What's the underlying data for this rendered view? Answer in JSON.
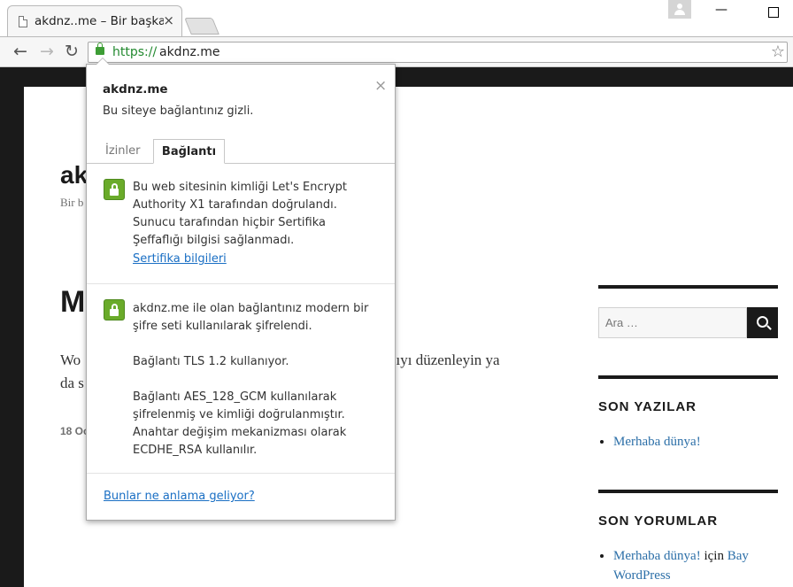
{
  "browser": {
    "tab_title": "akdnz..me – Bir başka",
    "tab_close": "×",
    "window_min": "—",
    "url_scheme": "https://",
    "url_host": "akdnz.me",
    "nav": {
      "back": "←",
      "forward": "→",
      "reload": "↻",
      "star": "☆"
    }
  },
  "page": {
    "site_title_fragment": "ak",
    "site_description_fragment": "Bir b",
    "post_title_fragment": "M",
    "post_body_line1_start": "Wo",
    "post_body_line1_end": "u yazıyı düzenleyin ya",
    "post_body_line2_start": "da s",
    "post_meta_fragment": "18 Oc"
  },
  "sidebar": {
    "search_placeholder": "Ara …",
    "recent_posts_title": "SON YAZILAR",
    "recent_posts": [
      "Merhaba dünya!"
    ],
    "recent_comments_title": "SON YORUMLAR",
    "recent_comment": {
      "post": "Merhaba dünya!",
      "connector": " için ",
      "author": "Bay WordPress"
    }
  },
  "popup": {
    "host": "akdnz.me",
    "close": "×",
    "status": "Bu siteye bağlantınız gizli.",
    "tabs": [
      "İzinler",
      "Bağlantı"
    ],
    "active_tab": "Bağlantı",
    "identity_lines": [
      "Bu web sitesinin kimliği Let's Encrypt",
      "Authority X1 tarafından doğrulandı.",
      "Sunucu tarafından hiçbir Sertifika",
      "Şeffaflığı bilgisi sağlanmadı."
    ],
    "cert_link": "Sertifika bilgileri",
    "encryption_lines_1": [
      "akdnz.me ile olan bağlantınız modern bir",
      "şifre seti kullanılarak şifrelendi."
    ],
    "encryption_tls": "Bağlantı TLS 1.2 kullanıyor.",
    "encryption_lines_2": [
      "Bağlantı AES_128_GCM kullanılarak",
      "şifrelenmiş ve kimliği doğrulanmıştır.",
      "Anahtar değişim mekanizması olarak",
      "ECDHE_RSA kullanılır."
    ],
    "footer_link": "Bunlar ne anlama geliyor?"
  }
}
